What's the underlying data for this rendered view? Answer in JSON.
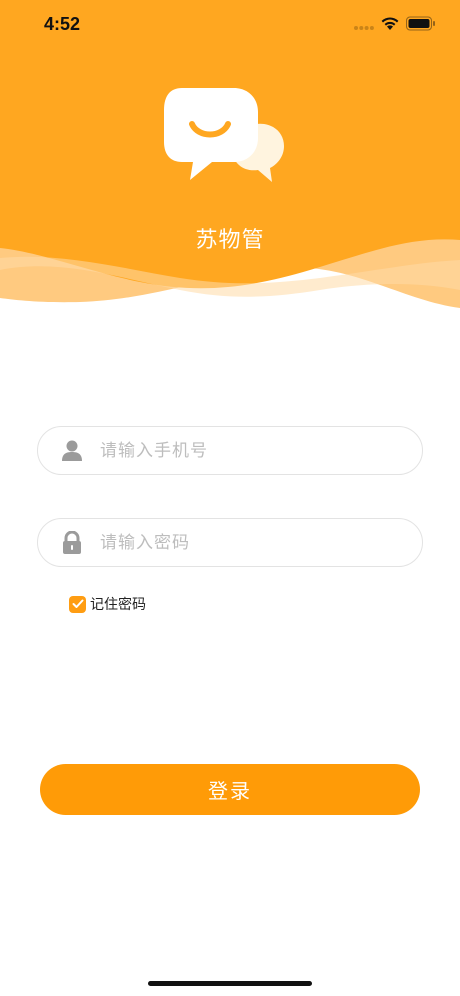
{
  "status_bar": {
    "time": "4:52"
  },
  "header": {
    "title": "苏物管",
    "logo_icon": "chat-bubbles-icon"
  },
  "form": {
    "phone": {
      "icon": "user-icon",
      "placeholder": "请输入手机号",
      "value": ""
    },
    "password": {
      "icon": "lock-icon",
      "placeholder": "请输入密码",
      "value": ""
    },
    "remember": {
      "label": "记住密码",
      "checked": true
    }
  },
  "actions": {
    "login_label": "登录"
  },
  "colors": {
    "primary": "#FF9B07",
    "header": "#FFA51F",
    "wave_light": "#FFCB82"
  }
}
